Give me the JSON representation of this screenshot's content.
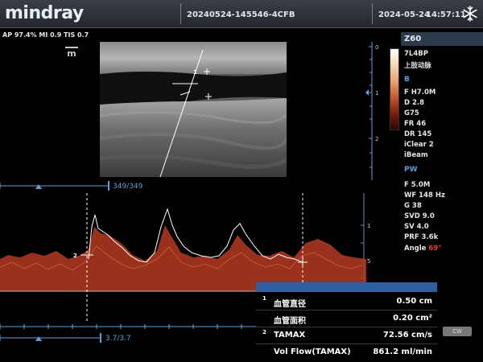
{
  "header": {
    "logo": "mindray",
    "study_id": "20240524-145546-4CFB",
    "date": "2024-05-24",
    "time": "14:57:11",
    "freeze_icon": "snowflake-icon"
  },
  "info": {
    "line": "AP 97.4%  MI 0.9  TIS 0.7",
    "badge": "m"
  },
  "depth_scale": {
    "ticks": [
      "0",
      "1",
      "2"
    ]
  },
  "b_image": {
    "markers": [
      "1"
    ]
  },
  "panel": {
    "model": "Z60",
    "probe": "7L4BP",
    "exam": "上肢动脉",
    "b_section": "B",
    "b_params": [
      "F H7.0M",
      "D 2.8",
      "G75",
      "FR 46",
      "DR 145",
      "iClear 2",
      "iBeam"
    ],
    "pw_section": "PW",
    "pw_params": [
      "F 5.0M",
      "WF 148 Hz",
      "G 38",
      "SVD 9.0",
      "SV 4.0",
      "PRF 3.6k"
    ],
    "angle_label": "Angle",
    "angle_value": "69°"
  },
  "spectrum": {
    "top_counter": "349/349",
    "bottom_counter": "3.7/3.7",
    "velocity_ticks": [
      "100",
      "50"
    ],
    "cursor_label": "2"
  },
  "measurements": {
    "rows": [
      {
        "num": "1",
        "label": "血管直径",
        "value": "0.50 cm"
      },
      {
        "num": "",
        "label": "血管面积",
        "value": "0.20 cm²"
      },
      {
        "num": "2",
        "label": "TAMAX",
        "value": "72.56 cm/s"
      },
      {
        "num": "",
        "label": "Vol Flow(TAMAX)",
        "value": "861.2 ml/min"
      }
    ]
  },
  "cw_tag": "CW",
  "colors": {
    "accent_blue": "#2f5f9e",
    "scale_blue": "#5f9fd6",
    "angle_red": "#ff3030",
    "trace_white": "#ffffff",
    "doppler_red": "#c8452a"
  }
}
